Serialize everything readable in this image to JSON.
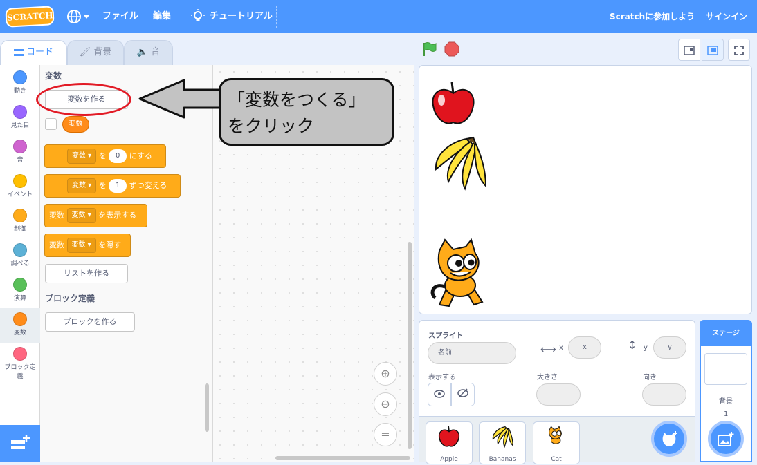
{
  "menubar": {
    "logo": "SCRATCH",
    "file": "ファイル",
    "edit": "編集",
    "tutorial": "チュートリアル",
    "join": "Scratchに参加しよう",
    "signin": "サインイン"
  },
  "tabs": [
    {
      "label": "コード"
    },
    {
      "label": "背景"
    },
    {
      "label": "音"
    }
  ],
  "categories": [
    {
      "label": "動き",
      "color": "#4c97ff"
    },
    {
      "label": "見た目",
      "color": "#9966ff"
    },
    {
      "label": "音",
      "color": "#cf63cf"
    },
    {
      "label": "イベント",
      "color": "#ffbf00"
    },
    {
      "label": "制御",
      "color": "#ffab19"
    },
    {
      "label": "調べる",
      "color": "#5cb1d6"
    },
    {
      "label": "演算",
      "color": "#59c059"
    },
    {
      "label": "変数",
      "color": "#ff8c1a"
    },
    {
      "label": "ブロック定",
      "label2": "義",
      "color": "#ff6680"
    }
  ],
  "palette": {
    "variables_title": "変数",
    "make_variable": "変数を作る",
    "variable_name": "変数",
    "blocks": {
      "set_var": "変数",
      "set_wo": "を",
      "set_value": "0",
      "set_suffix": "にする",
      "change_var": "変数",
      "change_wo": "を",
      "change_value": "1",
      "change_suffix": "ずつ変える",
      "show_prefix": "変数",
      "show_var": "変数",
      "show_suffix": "を表示する",
      "hide_prefix": "変数",
      "hide_var": "変数",
      "hide_suffix": "を隠す"
    },
    "make_list": "リストを作る",
    "my_blocks_title": "ブロック定義",
    "make_block": "ブロックを作る"
  },
  "annotation": {
    "line1": "「変数をつくる」",
    "line2": "をクリック"
  },
  "sprite_info": {
    "sprite_label": "スプライト",
    "name_placeholder": "名前",
    "x_label": "x",
    "x_placeholder": "x",
    "y_label": "y",
    "y_placeholder": "y",
    "show_label": "表示する",
    "size_label": "大きさ",
    "direction_label": "向き"
  },
  "sprites": [
    {
      "name": "Apple"
    },
    {
      "name": "Bananas"
    },
    {
      "name": "Cat"
    }
  ],
  "stage_panel": {
    "title": "ステージ",
    "backdrops_label": "背景",
    "backdrops_count": "1"
  },
  "colors": {
    "accent": "#4c97ff",
    "variables": "#ffab19",
    "highlight": "#e21b26"
  }
}
